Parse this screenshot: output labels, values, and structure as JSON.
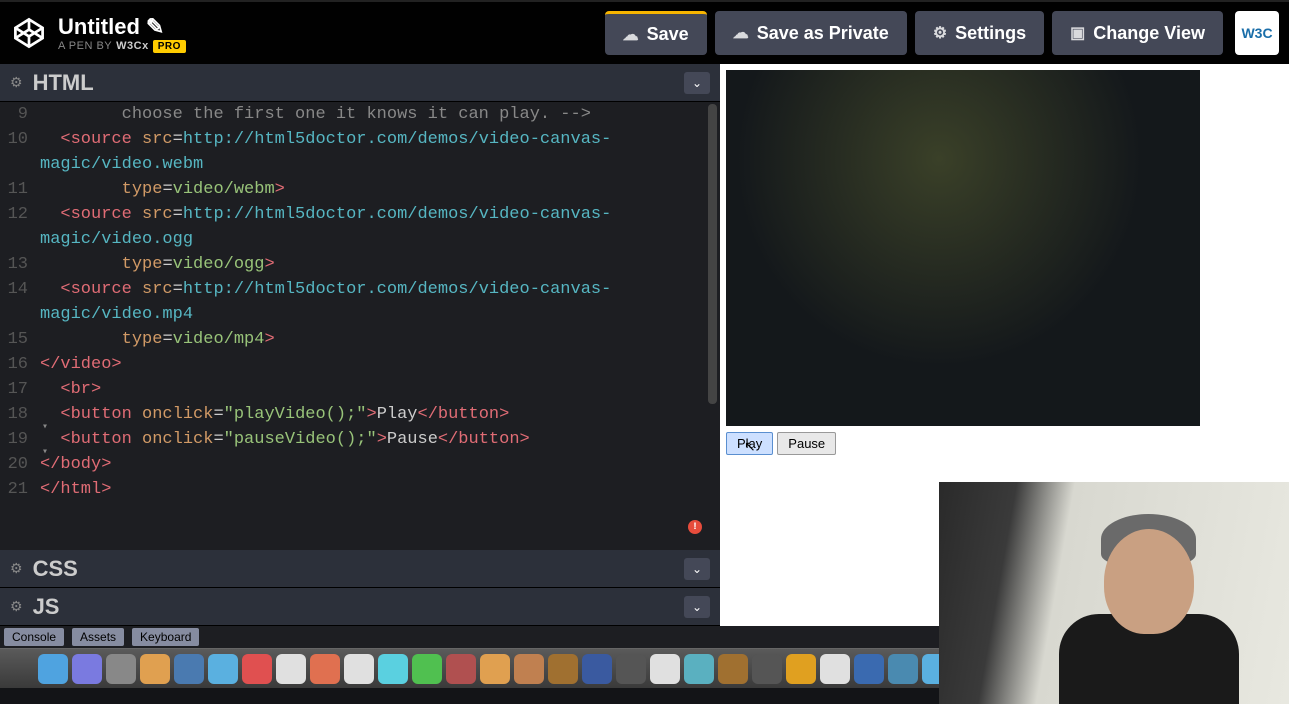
{
  "header": {
    "title": "Untitled",
    "subtitle_prefix": "A PEN BY",
    "author": "W3Cx",
    "pro": "PRO"
  },
  "buttons": {
    "save": "Save",
    "save_private": "Save as Private",
    "settings": "Settings",
    "change_view": "Change View"
  },
  "avatar": "W3C",
  "panels": {
    "html": "HTML",
    "css": "CSS",
    "js": "JS"
  },
  "code": {
    "l9": "        choose the first one it knows it can play. -->",
    "l10": "  <source src=http://html5doctor.com/demos/video-canvas-magic/video.webm",
    "l11": "        type=video/webm>",
    "l12": "  <source src=http://html5doctor.com/demos/video-canvas-magic/video.ogg",
    "l13": "        type=video/ogg>",
    "l14": "  <source src=http://html5doctor.com/demos/video-canvas-magic/video.mp4",
    "l15": "        type=video/mp4>",
    "l16": "</video>",
    "l17": "  <br>",
    "l18": "  <button onclick=\"playVideo();\">Play</button>",
    "l19": "  <button onclick=\"pauseVideo();\">Pause</button>",
    "l20": "</body>",
    "l21": "</html>"
  },
  "lines": {
    "n9": "9",
    "n10": "10",
    "n11": "11",
    "n12": "12",
    "n13": "13",
    "n14": "14",
    "n15": "15",
    "n16": "16",
    "n17": "17",
    "n18": "18",
    "n19": "19",
    "n20": "20",
    "n21": "21"
  },
  "preview": {
    "play": "Play",
    "pause": "Pause"
  },
  "footer": {
    "console": "Console",
    "assets": "Assets",
    "keyboard": "Keyboard"
  },
  "dock_colors": [
    "#4fa3e0",
    "#7a7ae0",
    "#888",
    "#e0a050",
    "#4a7ab0",
    "#5ab0e0",
    "#e05050",
    "#e0e0e0",
    "#e07050",
    "#e0e0e0",
    "#5ad0e0",
    "#50c050",
    "#b05050",
    "#e0a050",
    "#c08050",
    "#a07030",
    "#3a5aa0",
    "#555",
    "#e0e0e0",
    "#5ab0c0",
    "#a07030",
    "#555",
    "#e0a020",
    "#e0e0e0",
    "#3a6ab0",
    "#4a8ab0",
    "#5ab0e0",
    "#e0b020",
    "#50a050",
    "#e05050"
  ]
}
